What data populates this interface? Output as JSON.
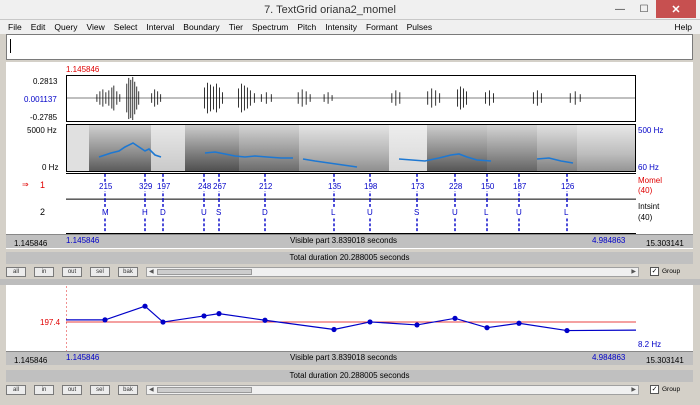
{
  "window": {
    "title": "7. TextGrid oriana2_momel",
    "minimize_glyph": "—",
    "maximize_glyph": "☐",
    "close_glyph": "✕"
  },
  "menu": [
    "File",
    "Edit",
    "Query",
    "View",
    "Select",
    "Interval",
    "Boundary",
    "Tier",
    "Spectrum",
    "Pitch",
    "Intensity",
    "Formant",
    "Pulses"
  ],
  "menu_help": "Help",
  "editor": {
    "cursor_time": "1.145846",
    "wave_max": "0.2813",
    "wave_cursor_value": "0.001137",
    "wave_min": "-0.2785",
    "spec_top": "5000 Hz",
    "spec_bottom": "0 Hz",
    "pitch_top": "500 Hz",
    "pitch_bottom": "60 Hz",
    "tier1_number": "1",
    "tier1_arrow": "⇒",
    "tier1_name": "Momel",
    "tier1_count": "(40)",
    "tier2_number": "2",
    "tier2_name": "Intsint",
    "tier2_count": "(40)",
    "tier1_points": [
      "215",
      "329",
      "197",
      "248",
      "267",
      "212",
      "135",
      "198",
      "173",
      "228",
      "150",
      "187",
      "126"
    ],
    "tier2_points": [
      "M",
      "H",
      "D",
      "U",
      "S",
      "D",
      "L",
      "U",
      "S",
      "U",
      "L",
      "U",
      "L"
    ],
    "info_left": "1.145846",
    "info_visible_start": "1.145846",
    "info_visible": "Visible part 3.839018 seconds",
    "info_visible_end": "4.984863",
    "info_total_end": "15.303141",
    "total_duration": "Total duration 20.288005 seconds"
  },
  "buttons": {
    "all": "all",
    "in": "in",
    "out": "out",
    "sel": "sel",
    "bak": "bak",
    "group": "Group",
    "group_checked": "✓"
  },
  "pitch_editor": {
    "ref_value": "197.4",
    "bottom_value": "8.2 Hz",
    "info_left": "1.145846",
    "info_visible_start": "1.145846",
    "info_visible": "Visible part 3.839018 seconds",
    "info_visible_end": "4.984863",
    "info_total_end": "15.303141",
    "total_duration": "Total duration 20.288005 seconds"
  }
}
